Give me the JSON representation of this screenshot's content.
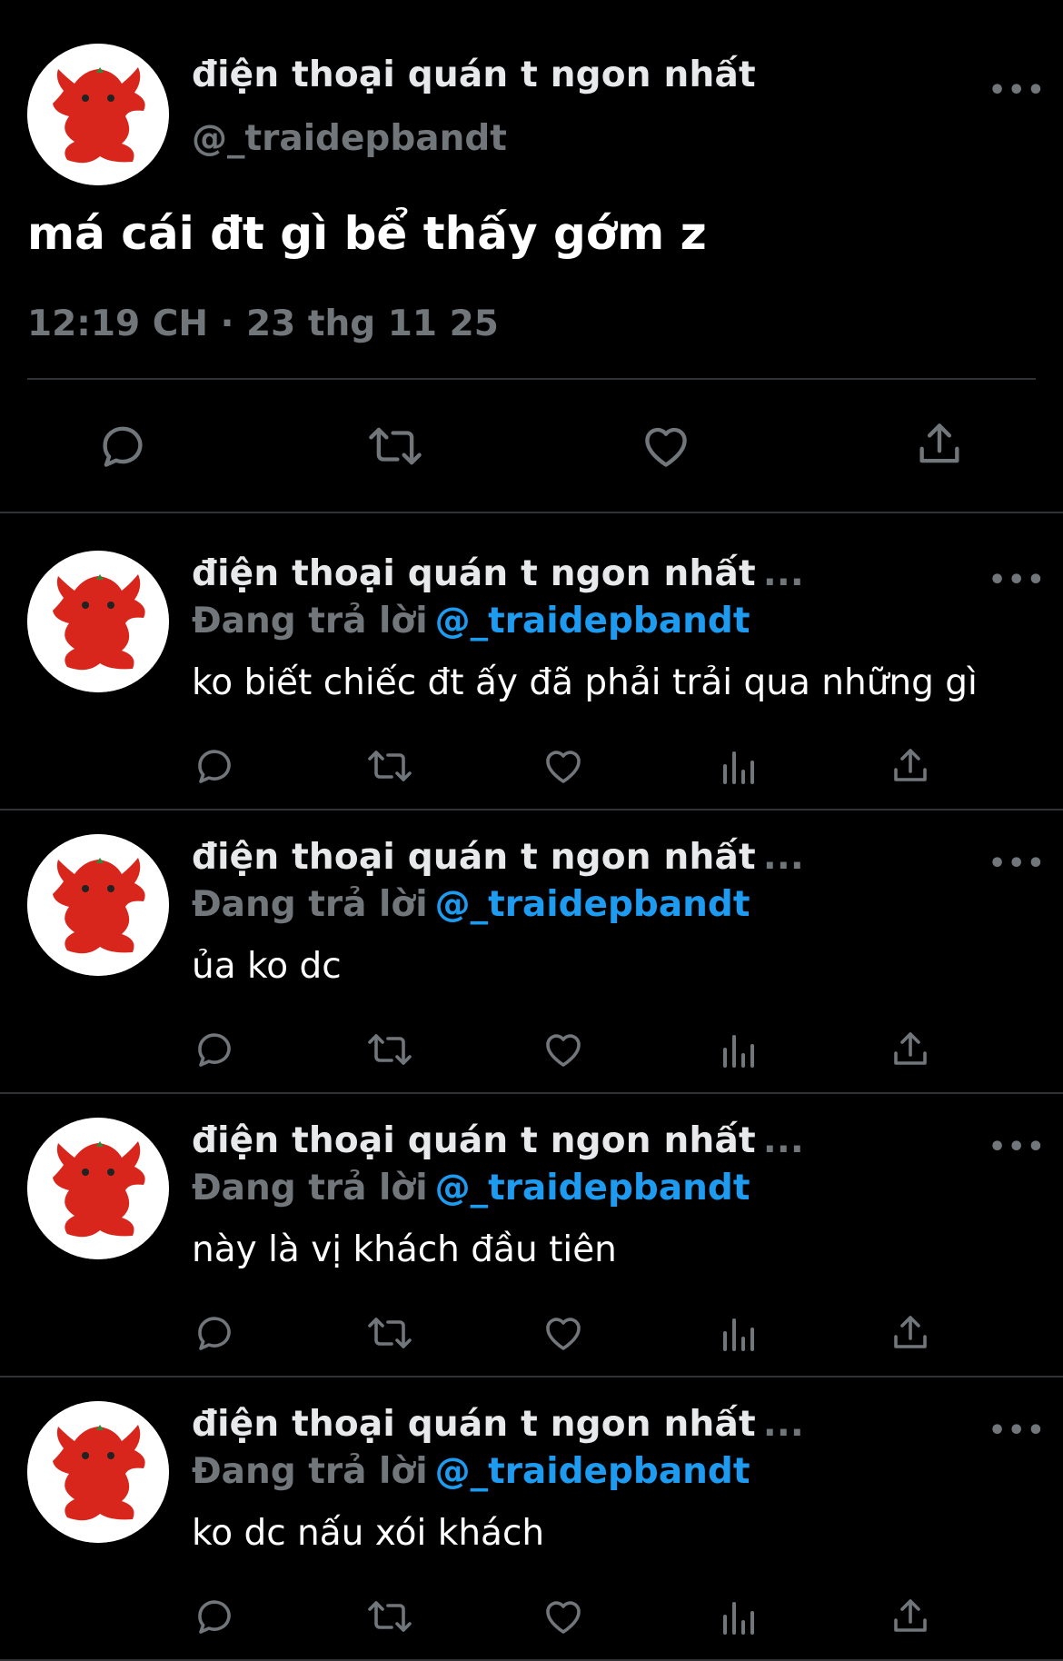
{
  "main_tweet": {
    "display_name": "điện thoại quán t ngon nhất",
    "handle": "@_traidepbandt",
    "text": "má cái đt gì bể thấy gớm z",
    "time": "12:19 CH",
    "separator": "·",
    "date": "23 thg 11 25",
    "more": "•••"
  },
  "replies": [
    {
      "display_name": "điện thoại quán t ngon nhất",
      "truncation": "...",
      "reply_prefix": "Đang trả lời",
      "mention": "@_traidepbandt",
      "text": "ko biết chiếc đt ấy đã phải trải qua những gì",
      "more": "•••"
    },
    {
      "display_name": "điện thoại quán t ngon nhất",
      "truncation": "...",
      "reply_prefix": "Đang trả lời",
      "mention": "@_traidepbandt",
      "text": "ủa ko dc",
      "more": "•••"
    },
    {
      "display_name": "điện thoại quán t ngon nhất",
      "truncation": "...",
      "reply_prefix": "Đang trả lời",
      "mention": "@_traidepbandt",
      "text": "này là vị khách đầu tiên",
      "more": "•••"
    },
    {
      "display_name": "điện thoại quán t ngon nhất",
      "truncation": "...",
      "reply_prefix": "Đang trả lời",
      "mention": "@_traidepbandt",
      "text": "ko dc nấu xói khách",
      "more": "•••"
    }
  ],
  "icons": [
    "reply-icon",
    "retweet-icon",
    "like-icon",
    "views-icon",
    "share-icon"
  ],
  "colors": {
    "background": "#000000",
    "text": "#e7e9ea",
    "muted": "#71767b",
    "mention": "#1d9bf0",
    "avatar_character": "#d9261c"
  }
}
